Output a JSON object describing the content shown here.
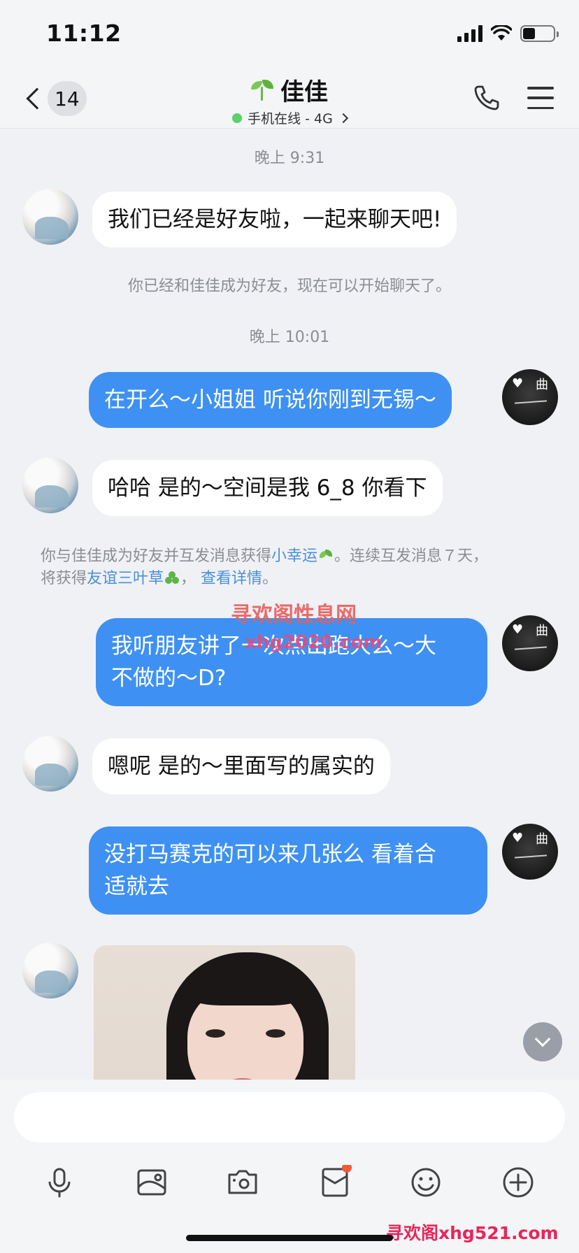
{
  "status_bar": {
    "time": "11:12"
  },
  "header": {
    "back_count": "14",
    "contact_name": "佳佳",
    "status": "手机在线 - 4G"
  },
  "chat": {
    "time1": "晚上 9:31",
    "msg1": "我们已经是好友啦，一起来聊天吧!",
    "system1": "你已经和佳佳成为好友，现在可以开始聊天了。",
    "time2": "晚上 10:01",
    "msg2": "在开么～小姐姐 听说你刚到无锡～",
    "msg3": "哈哈 是的～空间是我 6_8  你看下",
    "system2": {
      "part1": "你与佳佳成为好友并互发消息获得",
      "link1": "小幸运",
      "part2": "。连续互发消息７天，",
      "part3": "将获得",
      "link2": "友谊三叶草",
      "part4": "，",
      "link3": "查看详情",
      "part5": "。"
    },
    "msg4_line1": "我听朋友讲了一次点出跑大么～大",
    "msg4_line2": "不做的～D?",
    "msg5": "嗯呢 是的～里面写的属实的",
    "msg6_line1": "没打马赛克的可以来几张么 看着合",
    "msg6_line2": "适就去"
  },
  "watermarks": {
    "center_title": "寻欢阁性息网",
    "center_url": "xhg2020.com",
    "bottom": "寻欢阁xhg521.com"
  },
  "avatar_text": {
    "mark": "♥",
    "char": "曲"
  },
  "toolbar_icons": [
    "microphone-icon",
    "image-icon",
    "camera-icon",
    "red-envelope-icon",
    "emoji-icon",
    "plus-icon"
  ],
  "colors": {
    "bubble_blue": "#3e91f2",
    "link": "#4a90d9",
    "online": "#5ad16b",
    "badge": "#f05a3a"
  }
}
